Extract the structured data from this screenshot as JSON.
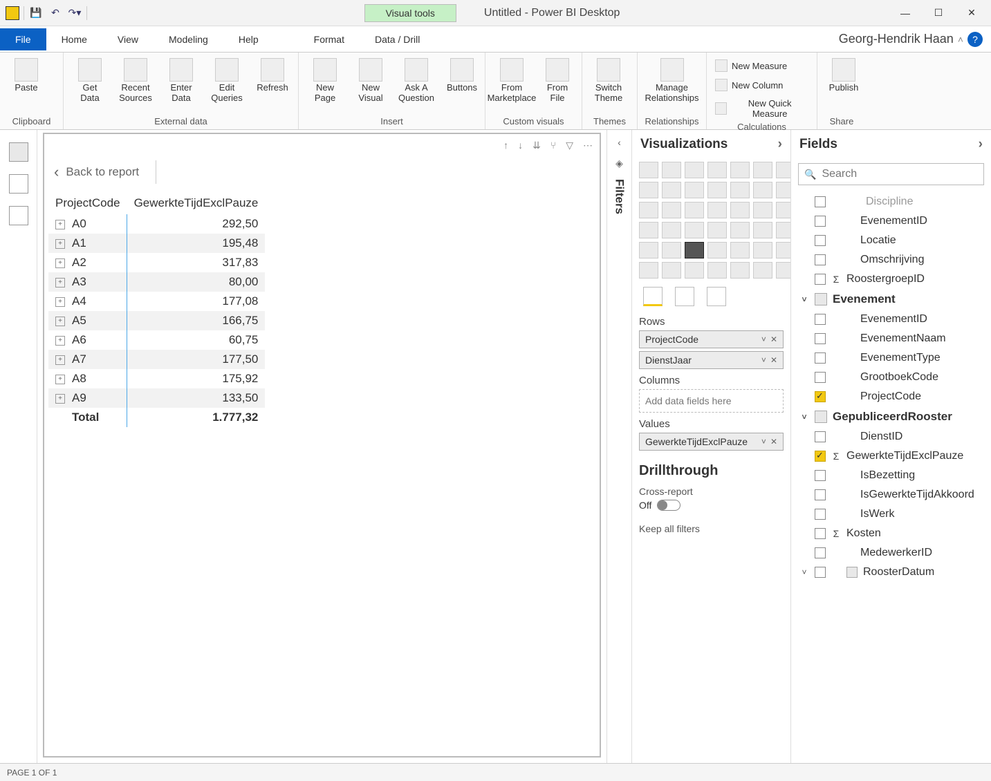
{
  "window": {
    "title": "Untitled - Power BI Desktop",
    "visual_tools": "Visual tools"
  },
  "user": "Georg-Hendrik Haan",
  "menu": {
    "file": "File",
    "tabs": [
      "Home",
      "View",
      "Modeling",
      "Help",
      "Format",
      "Data / Drill"
    ]
  },
  "ribbon": {
    "clipboard": {
      "label": "Clipboard",
      "paste": "Paste"
    },
    "external": {
      "label": "External data",
      "get": "Get\nData",
      "recent": "Recent\nSources",
      "enter": "Enter\nData",
      "edit": "Edit\nQueries",
      "refresh": "Refresh"
    },
    "insert": {
      "label": "Insert",
      "newpage": "New\nPage",
      "newvisual": "New\nVisual",
      "ask": "Ask A\nQuestion",
      "buttons": "Buttons"
    },
    "customvis": {
      "label": "Custom visuals",
      "market": "From\nMarketplace",
      "file": "From\nFile"
    },
    "themes": {
      "label": "Themes",
      "switch": "Switch\nTheme"
    },
    "rel": {
      "label": "Relationships",
      "manage": "Manage\nRelationships"
    },
    "calc": {
      "label": "Calculations",
      "m1": "New Measure",
      "m2": "New Column",
      "m3": "New Quick Measure"
    },
    "share": {
      "label": "Share",
      "publish": "Publish"
    }
  },
  "back_to_report": "Back to report",
  "matrix": {
    "cols": [
      "ProjectCode",
      "GewerkteTijdExclPauze"
    ],
    "rows": [
      {
        "code": "A0",
        "val": "292,50"
      },
      {
        "code": "A1",
        "val": "195,48"
      },
      {
        "code": "A2",
        "val": "317,83"
      },
      {
        "code": "A3",
        "val": "80,00"
      },
      {
        "code": "A4",
        "val": "177,08"
      },
      {
        "code": "A5",
        "val": "166,75"
      },
      {
        "code": "A6",
        "val": "60,75"
      },
      {
        "code": "A7",
        "val": "177,50"
      },
      {
        "code": "A8",
        "val": "175,92"
      },
      {
        "code": "A9",
        "val": "133,50"
      }
    ],
    "total_label": "Total",
    "total_val": "1.777,32"
  },
  "filters_label": "Filters",
  "vis_pane": "Visualizations",
  "wells": {
    "rows": "Rows",
    "rows_fields": [
      "ProjectCode",
      "DienstJaar"
    ],
    "cols": "Columns",
    "cols_placeholder": "Add data fields here",
    "values": "Values",
    "values_fields": [
      "GewerkteTijdExclPauze"
    ]
  },
  "drill": {
    "title": "Drillthrough",
    "cross": "Cross-report",
    "off": "Off",
    "keep": "Keep all filters"
  },
  "fields_pane": "Fields",
  "search_placeholder": "Search",
  "fields": {
    "orphan": [
      "EvenementID",
      "Locatie",
      "Omschrijving",
      "RoostergroepID"
    ],
    "orphan_top": "Discipline",
    "tables": [
      {
        "name": "Evenement",
        "fields": [
          {
            "n": "EvenementID"
          },
          {
            "n": "EvenementNaam"
          },
          {
            "n": "EvenementType"
          },
          {
            "n": "GrootboekCode"
          },
          {
            "n": "ProjectCode",
            "checked": true
          }
        ]
      },
      {
        "name": "GepubliceerdRooster",
        "fields": [
          {
            "n": "DienstID"
          },
          {
            "n": "GewerkteTijdExclPauze",
            "checked": true,
            "sigma": true
          },
          {
            "n": "IsBezetting"
          },
          {
            "n": "IsGewerkteTijdAkkoord"
          },
          {
            "n": "IsWerk"
          },
          {
            "n": "Kosten",
            "sigma": true
          },
          {
            "n": "MedewerkerID"
          },
          {
            "n": "RoosterDatum",
            "date": true,
            "collapsed": true
          }
        ]
      }
    ]
  },
  "status": "PAGE 1 OF 1"
}
